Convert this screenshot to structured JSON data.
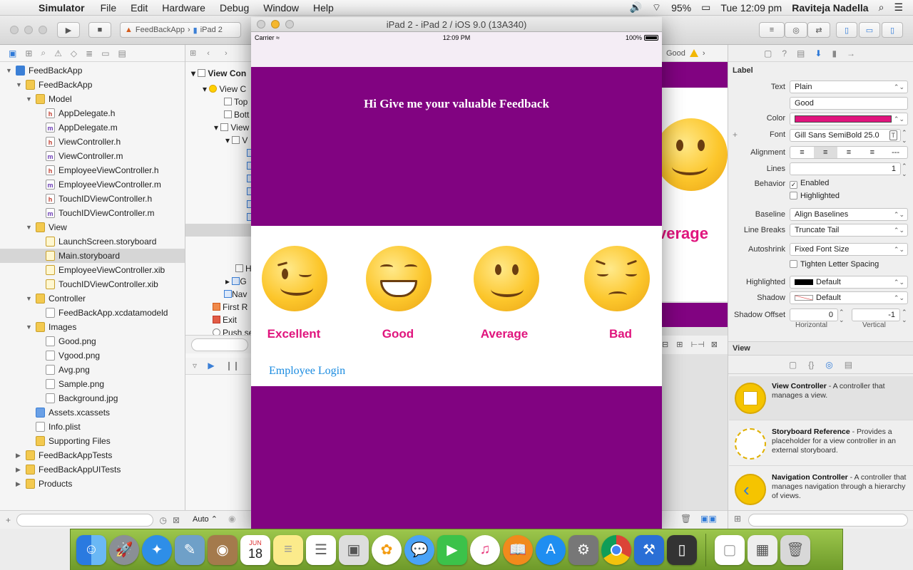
{
  "menubar": {
    "app_name": "Simulator",
    "items": [
      "File",
      "Edit",
      "Hardware",
      "Debug",
      "Window",
      "Help"
    ],
    "battery": "95%",
    "clock": "Tue 12:09 pm",
    "user": "Raviteja Nadella"
  },
  "toolbar": {
    "scheme_project": "FeedBackApp",
    "scheme_device": "iPad 2"
  },
  "navigator": {
    "items": [
      {
        "label": "FeedBackApp",
        "icon": "project-icon"
      },
      {
        "label": "FeedBackApp",
        "icon": "folder-icon"
      },
      {
        "label": "Model",
        "icon": "folder-icon"
      },
      {
        "label": "AppDelegate.h",
        "icon": "header-file-icon"
      },
      {
        "label": "AppDelegate.m",
        "icon": "implementation-file-icon"
      },
      {
        "label": "ViewController.h",
        "icon": "header-file-icon"
      },
      {
        "label": "ViewController.m",
        "icon": "implementation-file-icon"
      },
      {
        "label": "EmployeeViewController.h",
        "icon": "header-file-icon"
      },
      {
        "label": "EmployeeViewController.m",
        "icon": "implementation-file-icon"
      },
      {
        "label": "TouchIDViewController.h",
        "icon": "header-file-icon"
      },
      {
        "label": "TouchIDViewController.m",
        "icon": "implementation-file-icon"
      },
      {
        "label": "View",
        "icon": "folder-icon"
      },
      {
        "label": "LaunchScreen.storyboard",
        "icon": "storyboard-icon"
      },
      {
        "label": "Main.storyboard",
        "icon": "storyboard-icon"
      },
      {
        "label": "EmployeeViewController.xib",
        "icon": "xib-icon"
      },
      {
        "label": "TouchIDViewController.xib",
        "icon": "xib-icon"
      },
      {
        "label": "Controller",
        "icon": "folder-icon"
      },
      {
        "label": "FeedBackApp.xcdatamodeld",
        "icon": "datamodel-icon"
      },
      {
        "label": "Images",
        "icon": "folder-icon"
      },
      {
        "label": "Good.png",
        "icon": "image-file-icon"
      },
      {
        "label": "Vgood.png",
        "icon": "image-file-icon"
      },
      {
        "label": "Avg.png",
        "icon": "image-file-icon"
      },
      {
        "label": "Sample.png",
        "icon": "image-file-icon"
      },
      {
        "label": "Background.jpg",
        "icon": "image-file-icon"
      },
      {
        "label": "Assets.xcassets",
        "icon": "assets-icon"
      },
      {
        "label": "Info.plist",
        "icon": "plist-icon"
      },
      {
        "label": "Supporting Files",
        "icon": "folder-icon"
      },
      {
        "label": "FeedBackAppTests",
        "icon": "folder-icon"
      },
      {
        "label": "FeedBackAppUITests",
        "icon": "folder-icon"
      },
      {
        "label": "Products",
        "icon": "folder-icon"
      }
    ],
    "selected": "Main.storyboard"
  },
  "outline": {
    "items": [
      "View Con",
      "View C",
      "Top",
      "Bott",
      "View",
      "V",
      "H",
      "G",
      "Nav",
      "First R",
      "Exit",
      "Push se"
    ]
  },
  "canvas": {
    "jump_label": "Good",
    "partial_label": "verage"
  },
  "bottombar": {
    "auto_label": "Auto"
  },
  "simulator": {
    "title": "iPad 2 - iPad 2 / iOS 9.0 (13A340)",
    "status_carrier": "Carrier",
    "status_time": "12:09 PM",
    "status_battery": "100%",
    "headline": "Hi Give me your valuable Feedback",
    "moods": [
      "Excellent",
      "Good",
      "Average",
      "Bad"
    ],
    "employee_link": "Employee Login",
    "colors": {
      "purple": "#810381",
      "label_pink": "#e0147d",
      "link_blue": "#1a8be0"
    }
  },
  "inspector": {
    "label_section": "Label",
    "text_type": "Plain",
    "text_value": "Good",
    "color_swatch": "#e0147d",
    "font": "Gill Sans SemiBold 25.0",
    "lines": "1",
    "behavior_enabled": "Enabled",
    "behavior_highlighted": "Highlighted",
    "baseline": "Align Baselines",
    "line_breaks": "Truncate Tail",
    "autoshrink": "Fixed Font Size",
    "tighten": "Tighten Letter Spacing",
    "highlighted_value": "Default",
    "shadow_value": "Default",
    "shadow_offset_h": "0",
    "shadow_offset_v": "-1",
    "labels": {
      "text": "Text",
      "color": "Color",
      "font": "Font",
      "alignment": "Alignment",
      "lines": "Lines",
      "behavior": "Behavior",
      "baseline": "Baseline",
      "line_breaks": "Line Breaks",
      "autoshrink": "Autoshrink",
      "highlighted": "Highlighted",
      "shadow": "Shadow",
      "shadow_offset": "Shadow Offset",
      "horizontal": "Horizontal",
      "vertical": "Vertical"
    },
    "view_section": "View",
    "library": [
      {
        "title": "View Controller",
        "desc": " - A controller that manages a view."
      },
      {
        "title": "Storyboard Reference",
        "desc": " - Provides a placeholder for a view controller in an external storyboard."
      },
      {
        "title": "Navigation Controller",
        "desc": " - A controller that manages navigation through a hierarchy of views."
      }
    ]
  },
  "dock": {
    "apps": [
      "finder-icon",
      "launchpad-icon",
      "safari-icon",
      "preview-icon",
      "contacts-icon",
      "calendar-icon",
      "notes-icon",
      "reminders-icon",
      "photos-booth-icon",
      "photos-icon",
      "messages-icon",
      "facetime-icon",
      "itunes-icon",
      "ibooks-icon",
      "appstore-icon",
      "system-prefs-icon",
      "chrome-icon",
      "xcode-icon",
      "simulator-icon",
      "document-icon",
      "preview-image-icon",
      "trash-icon"
    ],
    "calendar_month": "JUN",
    "calendar_day": "18"
  }
}
